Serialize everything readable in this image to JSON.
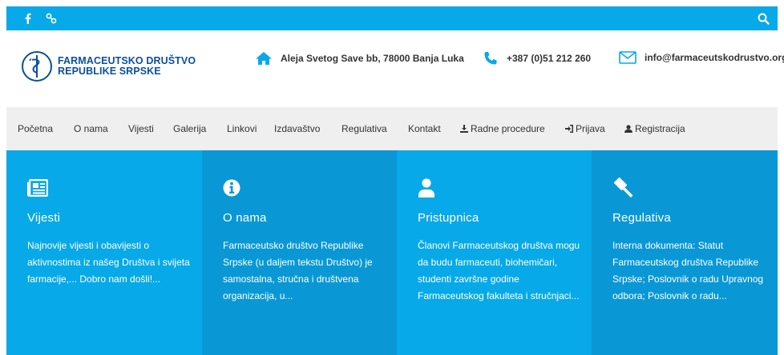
{
  "topbar": {
    "social": [
      "facebook-icon",
      "link-icon"
    ],
    "search_icon": "search-icon",
    "color": "#07a9e8"
  },
  "header": {
    "logo_line1": "FARMACEUTSKO DRUŠTVO",
    "logo_line2": "REPUBLIKE SRPSKE",
    "address": "Aleja Svetog Save bb, 78000 Banja Luka",
    "phone": "+387 (0)51 212 260",
    "email": "info@farmaceutskodrustvo.org"
  },
  "nav": {
    "items": [
      {
        "label": "Početna"
      },
      {
        "label": "O nama"
      },
      {
        "label": "Vijesti"
      },
      {
        "label": "Galerija"
      },
      {
        "label": "Linkovi"
      },
      {
        "label": "Izdavaštvo"
      },
      {
        "label": "Regulativa"
      },
      {
        "label": "Kontakt"
      },
      {
        "label": "Radne procedure",
        "icon": "download-icon"
      },
      {
        "label": "Prijava",
        "icon": "sign-in-icon"
      },
      {
        "label": "Registracija",
        "icon": "user-icon"
      }
    ]
  },
  "cards": [
    {
      "title": "Vijesti",
      "icon": "newspaper-icon",
      "text": "Najnovije vijesti i obavijesti o aktivnostima iz našeg Društva i svijeta farmacije,... Dobro nam došli!...",
      "color": "#07a9e8"
    },
    {
      "title": "O nama",
      "icon": "info-circle-icon",
      "text": "Farmaceutsko društvo Republike Srpske (u daljem tekstu Društvo) je samostalna, stručna i društvena organizacija, u...",
      "color": "#0998d5"
    },
    {
      "title": "Pristupnica",
      "icon": "user-icon",
      "text": "Članovi Farmaceutskog društva mogu da budu farmaceuti, biohemičari, studenti završne godine Farmaceutskog fakulteta i stručnjaci...",
      "color": "#07a9e8"
    },
    {
      "title": "Regulativa",
      "icon": "gavel-icon",
      "text": "Interna dokumenta: Statut Farmaceutskog društva Republike Srpske; Poslovnik o radu Upravnog odbora; Poslovnik o radu...",
      "color": "#0998d5"
    }
  ]
}
